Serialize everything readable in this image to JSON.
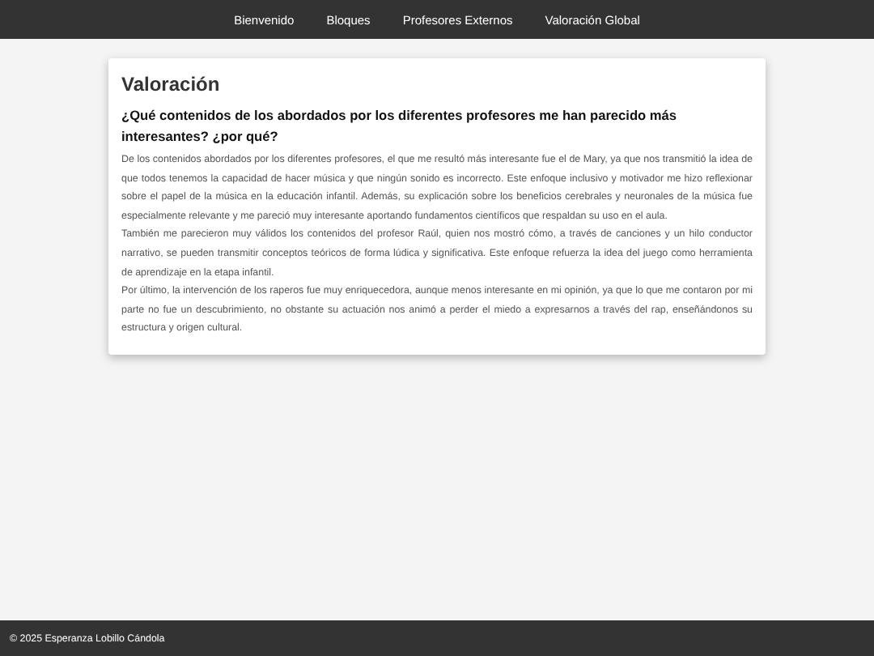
{
  "nav": {
    "items": [
      "Bienvenido",
      "Bloques",
      "Profesores Externos",
      "Valoración Global"
    ]
  },
  "card": {
    "title": "Valoración",
    "question": "¿Qué contenidos de los abordados por los diferentes profesores me han parecido más interesantes? ¿por qué?",
    "paragraphs": [
      "De los contenidos abordados por los diferentes profesores, el que me resultó más interesante fue el de Mary, ya que nos transmitió la idea de que todos tenemos la capacidad de hacer música y que ningún sonido es incorrecto. Este enfoque inclusivo y motivador me hizo reflexionar sobre el papel de la música en la educación infantil. Además, su explicación sobre los beneficios cerebrales y neuronales de la música fue especialmente relevante y me pareció muy interesante aportando fundamentos científicos que respaldan su uso en el aula.",
      "También me parecieron muy válidos los contenidos del profesor Raúl, quien nos mostró cómo, a través de canciones y un hilo conductor narrativo, se pueden transmitir conceptos teóricos de forma lúdica y significativa. Este enfoque refuerza la idea del juego como herramienta de aprendizaje en la etapa infantil.",
      "Por último, la intervención de los raperos fue muy enriquecedora, aunque menos interesante en mi opinión, ya que lo que me contaron por mi parte no fue un descubrimiento, no obstante su actuación nos animó a perder el miedo a expresarnos a través del rap, enseñándonos su estructura y origen cultural."
    ]
  },
  "footer": {
    "text": "© 2025 Esperanza Lobillo Cándola"
  }
}
